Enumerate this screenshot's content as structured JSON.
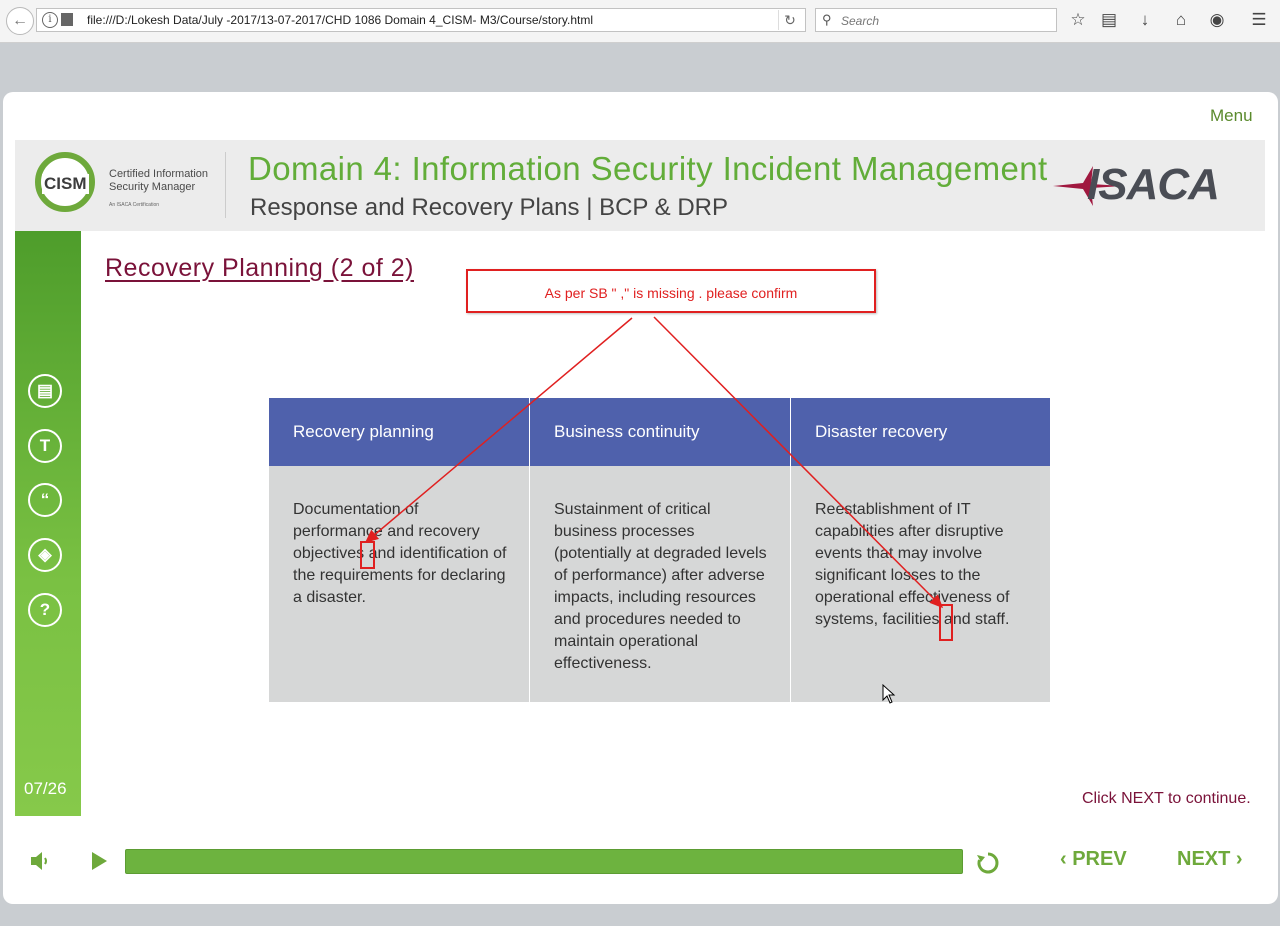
{
  "browser": {
    "url": "file:///D:/Lokesh Data/July -2017/13-07-2017/CHD 1086 Domain 4_CISM- M3/Course/story.html",
    "search_placeholder": "Search"
  },
  "course": {
    "menu_label": "Menu",
    "logo": {
      "mark": "CISM",
      "line1": "Certified Information",
      "line2": "Security Manager",
      "line3": "An ISACA Certification"
    },
    "title": "Domain 4: Information Security Incident Management",
    "subtitle": "Response and Recovery Plans | BCP & DRP",
    "brand": "ISACA",
    "page_indicator": "07/26"
  },
  "slide": {
    "heading": "Recovery Planning (2 of 2)",
    "review_note": "As per SB \" ,\" is missing . please confirm",
    "table": {
      "headers": [
        "Recovery planning",
        "Business continuity",
        "Disaster recovery"
      ],
      "cells": [
        "Documentation of performance and recovery objectives and identification of the requirements for declaring a disaster.",
        "Sustainment of critical business processes (potentially at degraded levels of performance) after adverse impacts, including resources and procedures needed to maintain operational effectiveness.",
        "Reestablishment of IT capabilities after disruptive events that may involve significant losses to the operational effectiveness of systems, facilities and staff."
      ]
    },
    "instruction": "Click NEXT to continue."
  },
  "nav": {
    "prev_label": "PREV",
    "next_label": "NEXT",
    "progress_fraction": 1.0
  },
  "colors": {
    "brand_green": "#6ea93b",
    "header_blue": "#4f61ac",
    "title_maroon": "#7a1239",
    "annotation_red": "#e02020"
  }
}
